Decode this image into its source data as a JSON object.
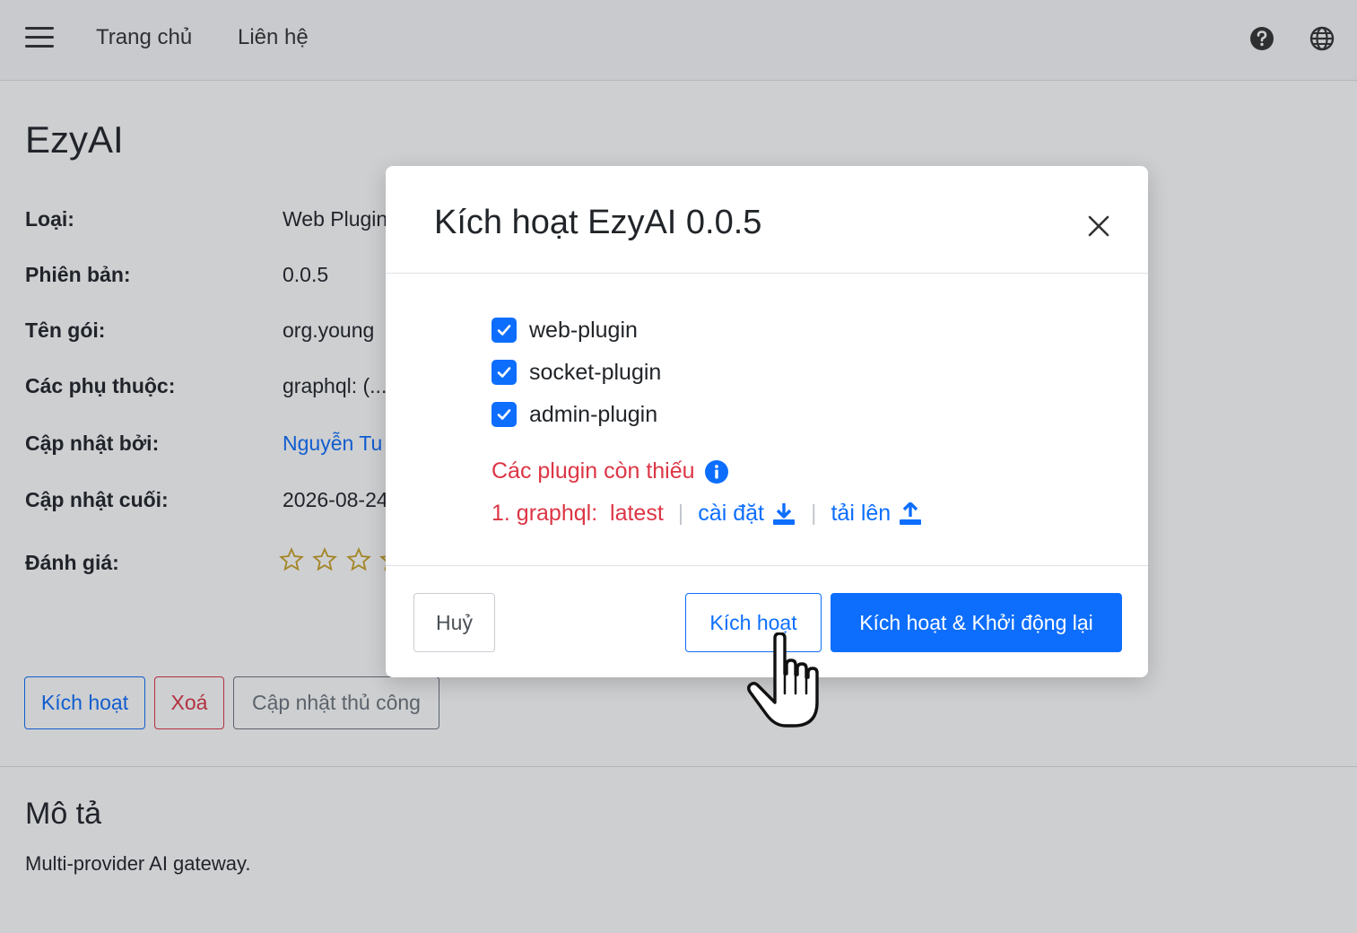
{
  "navbar": {
    "home": "Trang chủ",
    "contact": "Liên hệ"
  },
  "page": {
    "title": "EzyAI",
    "fields": [
      {
        "label": "Loại:",
        "value": "Web Plugin"
      },
      {
        "label": "Phiên bản:",
        "value": "0.0.5"
      },
      {
        "label": "Tên gói:",
        "value": "org.young"
      },
      {
        "label": "Các phụ thuộc:",
        "value": "graphql: (..."
      },
      {
        "label": "Cập nhật bởi:",
        "value": "Nguyễn Tu"
      },
      {
        "label": "Cập nhật cuối:",
        "value": "2026-08-24"
      },
      {
        "label": "Đánh giá:",
        "value": ""
      }
    ],
    "rating": {
      "value": 0,
      "max": 5
    },
    "buttons": {
      "activate": "Kích hoạt",
      "delete": "Xoá",
      "manual_update": "Cập nhật thủ công"
    },
    "description": {
      "title": "Mô tả",
      "text": "Multi-provider AI gateway."
    }
  },
  "modal": {
    "title": "Kích hoạt EzyAI 0.0.5",
    "plugins": [
      {
        "label": "web-plugin",
        "checked": true
      },
      {
        "label": "socket-plugin",
        "checked": true
      },
      {
        "label": "admin-plugin",
        "checked": true
      }
    ],
    "missing_title": "Các plugin còn thiếu",
    "missing": [
      {
        "name": "1. graphql:  latest",
        "install": "cài đặt",
        "upload": "tải lên"
      }
    ],
    "buttons": {
      "cancel": "Huỷ",
      "activate": "Kích hoạt",
      "activate_restart": "Kích hoạt & Khởi động lại"
    }
  },
  "colors": {
    "primary": "#0d6efd",
    "danger": "#dc3545",
    "secondary": "#6c757d",
    "star": "#c9a227"
  }
}
